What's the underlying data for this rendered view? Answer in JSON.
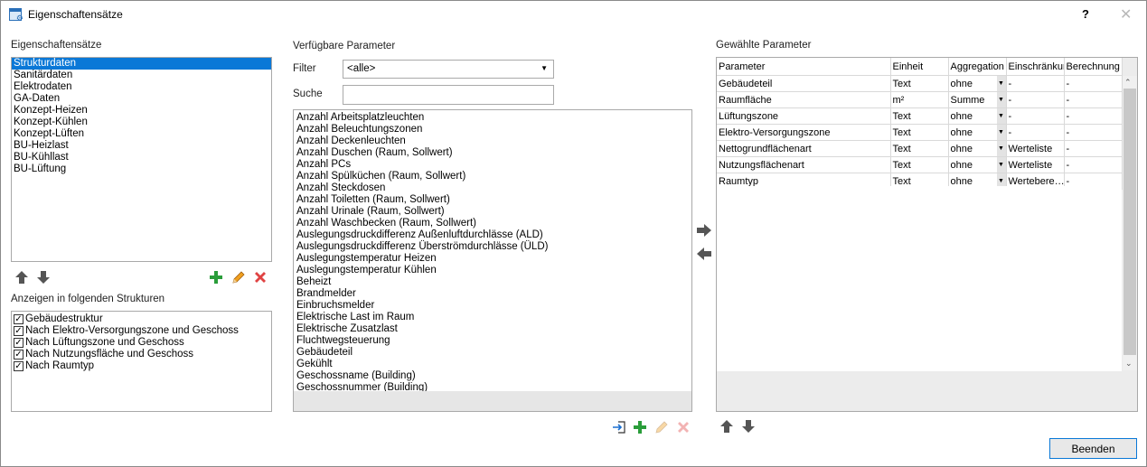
{
  "window": {
    "title": "Eigenschaftensätze",
    "help": "?",
    "close": "✕"
  },
  "left": {
    "sets_label": "Eigenschaftensätze",
    "sets": [
      "Strukturdaten",
      "Sanitärdaten",
      "Elektrodaten",
      "GA-Daten",
      "Konzept-Heizen",
      "Konzept-Kühlen",
      "Konzept-Lüften",
      "BU-Heizlast",
      "BU-Kühllast",
      "BU-Lüftung"
    ],
    "selected_index": 0,
    "structures_label": "Anzeigen in folgenden Strukturen",
    "structures": [
      {
        "label": "Gebäudestruktur",
        "checked": true
      },
      {
        "label": "Nach Elektro-Versorgungszone und Geschoss",
        "checked": true
      },
      {
        "label": "Nach Lüftungszone und Geschoss",
        "checked": true
      },
      {
        "label": "Nach Nutzungsfläche und Geschoss",
        "checked": true
      },
      {
        "label": "Nach Raumtyp",
        "checked": true
      }
    ]
  },
  "middle": {
    "label": "Verfügbare Parameter",
    "filter_label": "Filter",
    "filter_value": "<alle>",
    "search_label": "Suche",
    "search_value": "",
    "params": [
      "Anzahl Arbeitsplatzleuchten",
      "Anzahl Beleuchtungszonen",
      "Anzahl Deckenleuchten",
      "Anzahl Duschen (Raum, Sollwert)",
      "Anzahl PCs",
      "Anzahl Spülküchen (Raum, Sollwert)",
      "Anzahl Steckdosen",
      "Anzahl Toiletten (Raum, Sollwert)",
      "Anzahl Urinale (Raum, Sollwert)",
      "Anzahl Waschbecken (Raum, Sollwert)",
      "Auslegungsdruckdifferenz Außenluftdurchlässe (ALD)",
      "Auslegungsdruckdifferenz Überströmdurchlässe (ÜLD)",
      "Auslegungstemperatur Heizen",
      "Auslegungstemperatur Kühlen",
      "Beheizt",
      "Brandmelder",
      "Einbruchsmelder",
      "Elektrische Last im Raum",
      "Elektrische Zusatzlast",
      "Fluchtwegsteuerung",
      "Gebäudeteil",
      "Gekühlt",
      "Geschossname (Building)",
      "Geschossnummer (Building)"
    ]
  },
  "right": {
    "label": "Gewählte Parameter",
    "columns": [
      "Parameter",
      "Einheit",
      "Aggregation",
      "Einschränkur",
      "Berechnung"
    ],
    "rows": [
      [
        "Gebäudeteil",
        "Text",
        "ohne",
        "-",
        "-"
      ],
      [
        "Raumfläche",
        "m²",
        "Summe",
        "-",
        "-"
      ],
      [
        "Lüftungszone",
        "Text",
        "ohne",
        "-",
        "-"
      ],
      [
        "Elektro-Versorgungszone",
        "Text",
        "ohne",
        "-",
        "-"
      ],
      [
        "Nettogrundflächenart",
        "Text",
        "ohne",
        "Werteliste",
        "-"
      ],
      [
        "Nutzungsflächenart",
        "Text",
        "ohne",
        "Werteliste",
        "-"
      ],
      [
        "Raumtyp",
        "Text",
        "ohne",
        "Wertebere…",
        "-"
      ]
    ]
  },
  "footer": {
    "close_button": "Beenden"
  },
  "colors": {
    "accent": "#0a78d7",
    "green": "#2a9d3a",
    "red": "#e04343"
  }
}
